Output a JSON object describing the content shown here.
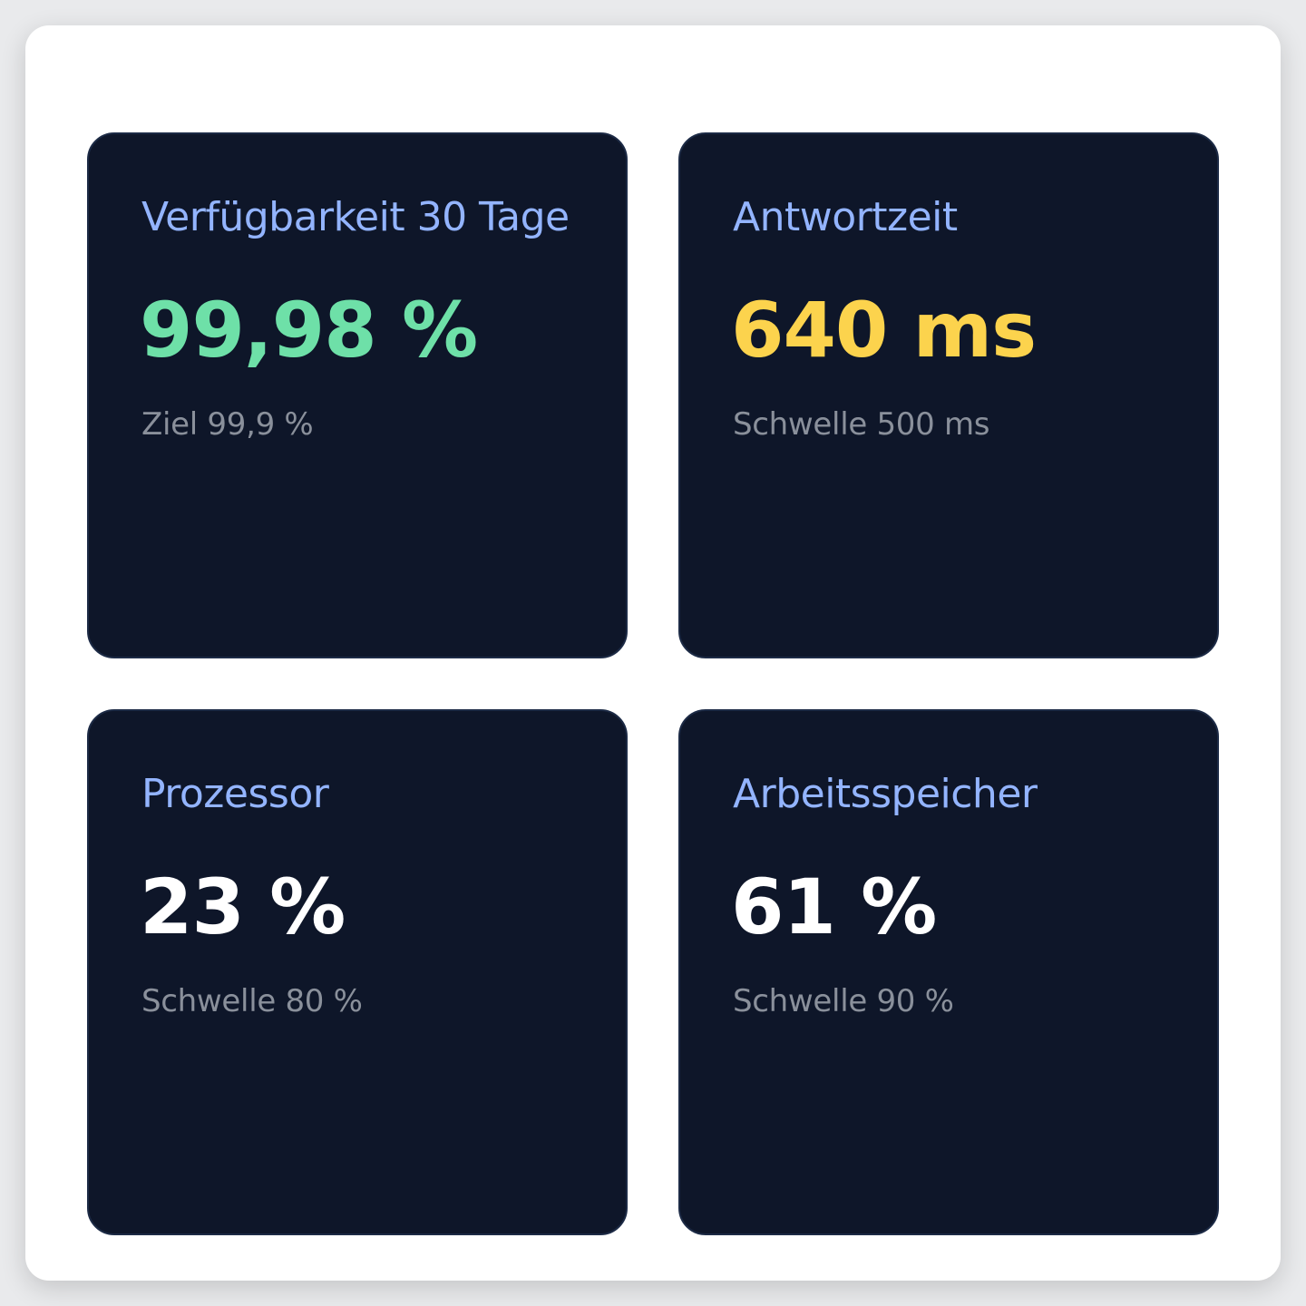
{
  "cards": [
    {
      "title": "Verfügbarkeit 30 Tage",
      "value": "99,98 %",
      "subtitle": "Ziel 99,9 %",
      "value_color": "#6ee0a8"
    },
    {
      "title": "Antwortzeit",
      "value": "640 ms",
      "subtitle": "Schwelle 500 ms",
      "value_color": "#fcd34d"
    },
    {
      "title": "Prozessor",
      "value": "23 %",
      "subtitle": "Schwelle 80 %",
      "value_color": "#ffffff"
    },
    {
      "title": "Arbeitsspeicher",
      "value": "61 %",
      "subtitle": "Schwelle 90 %",
      "value_color": "#ffffff"
    }
  ],
  "colors": {
    "card_background": "#0e1629",
    "title": "#93b4ff",
    "subtitle": "#8a909b",
    "panel_background": "#ffffff"
  }
}
